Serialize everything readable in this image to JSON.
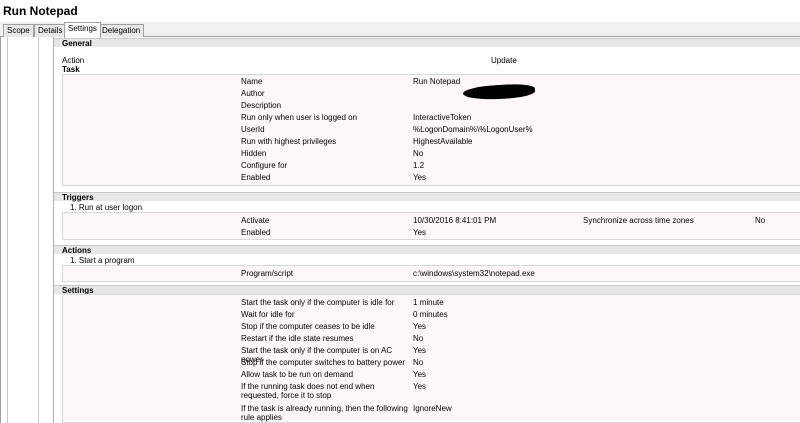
{
  "window": {
    "title": "Run Notepad"
  },
  "tabs": [
    "Scope",
    "Details",
    "Settings",
    "Delegation"
  ],
  "general": {
    "heading": "General",
    "action_label": "Action",
    "action_value": "Update",
    "task_heading": "Task",
    "rows": [
      {
        "label": "Name",
        "value": "Run Notepad"
      },
      {
        "label": "Author",
        "value": ""
      },
      {
        "label": "Description",
        "value": ""
      },
      {
        "label": "Run only when user is logged on",
        "value": "InteractiveToken"
      },
      {
        "label": "UserId",
        "value": "%LogonDomain%\\%LogonUser%"
      },
      {
        "label": "Run with highest privileges",
        "value": "HighestAvailable"
      },
      {
        "label": "Hidden",
        "value": "No"
      },
      {
        "label": "Configure for",
        "value": "1.2"
      },
      {
        "label": "Enabled",
        "value": "Yes"
      }
    ]
  },
  "triggers": {
    "heading": "Triggers",
    "item": "1. Run at user logon",
    "activate_label": "Activate",
    "activate_value": "10/30/2016 8:41:01 PM",
    "sync_label": "Synchronize across time zones",
    "sync_value": "No",
    "enabled_label": "Enabled",
    "enabled_value": "Yes"
  },
  "actions": {
    "heading": "Actions",
    "item": "1. Start a program",
    "program_label": "Program/script",
    "program_value": "c:\\windows\\system32\\notepad.exe"
  },
  "settings": {
    "heading": "Settings",
    "rows": [
      {
        "label": "Start the task only if the computer is idle for",
        "value": "1 minute"
      },
      {
        "label": "Wait for idle for",
        "value": "0 minutes"
      },
      {
        "label": "Stop if the computer ceases to be idle",
        "value": "Yes"
      },
      {
        "label": "Restart if the idle state resumes",
        "value": "No"
      },
      {
        "label": "Start the task only if the computer is on AC power",
        "value": "Yes"
      },
      {
        "label": "Stop if the computer switches to battery power",
        "value": "No"
      },
      {
        "label": "Allow task to be run on demand",
        "value": "Yes"
      },
      {
        "label": "If the running task does not end when requested, force it to stop",
        "value": "Yes"
      },
      {
        "label": "If the task is already running, then the following rule applies",
        "value": "IgnoreNew"
      }
    ]
  }
}
